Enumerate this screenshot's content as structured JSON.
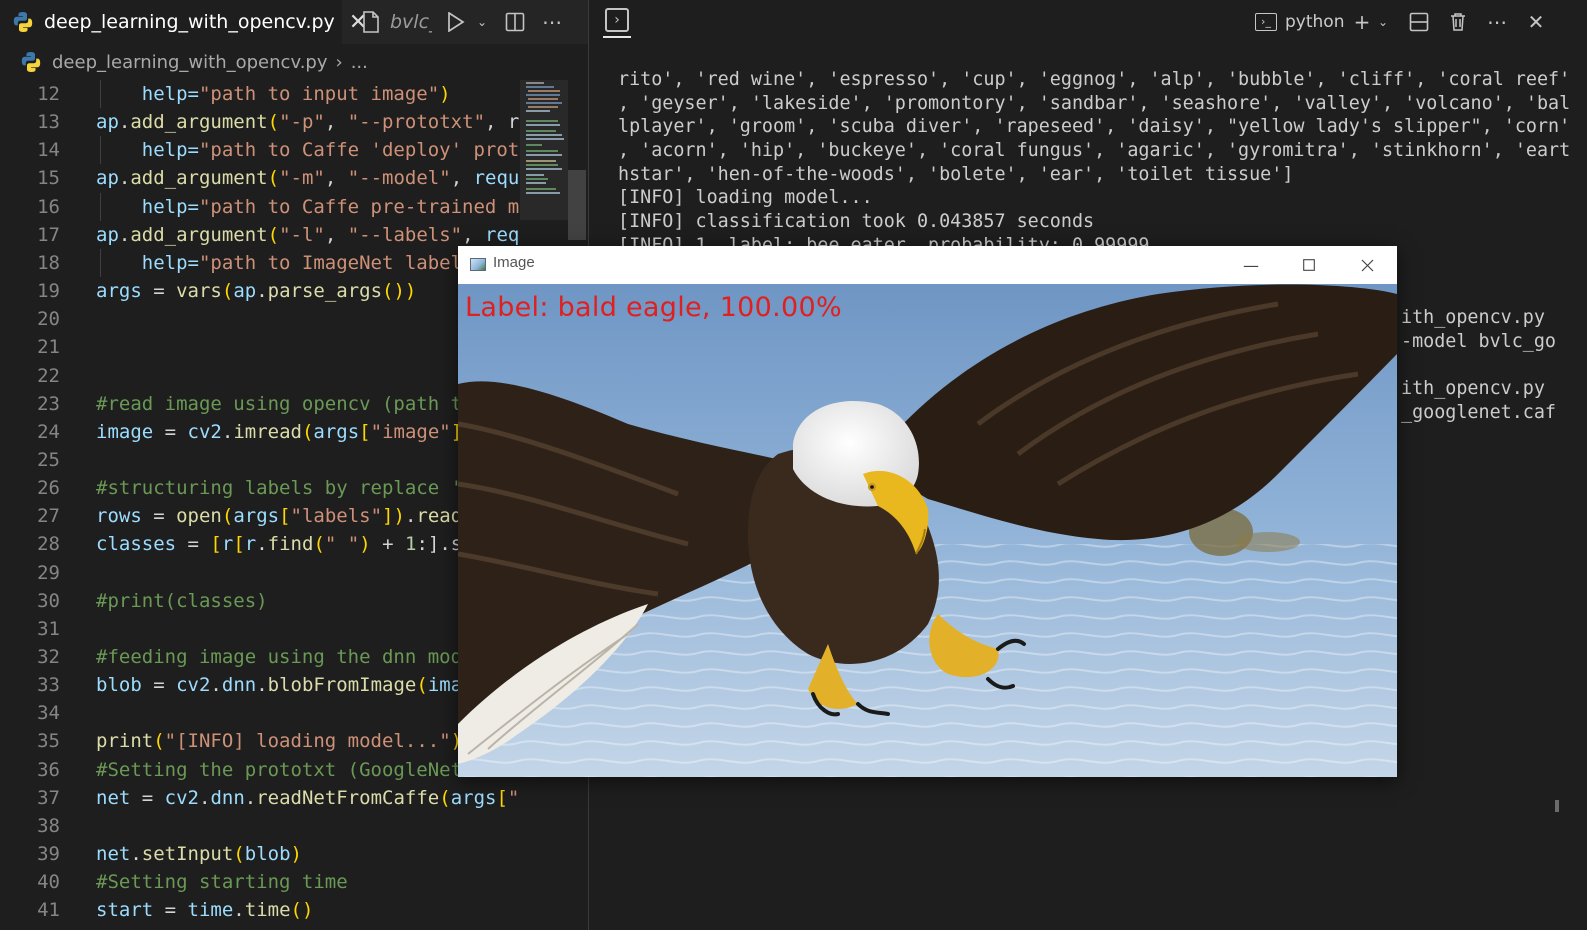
{
  "editor": {
    "active_tab": "deep_learning_with_opencv.py",
    "inactive_tab": "bvlc_",
    "breadcrumb_file": "deep_learning_with_opencv.py",
    "breadcrumb_more": "...",
    "lines": [
      {
        "n": "12",
        "segs": [
          [
            "    help=",
            "var"
          ],
          [
            "\"path to input image\"",
            "str"
          ],
          [
            ")",
            "br"
          ]
        ]
      },
      {
        "n": "13",
        "segs": [
          [
            "ap",
            "var"
          ],
          [
            ".",
            "op"
          ],
          [
            "add_argument",
            "fn"
          ],
          [
            "(",
            "br"
          ],
          [
            "\"-p\"",
            "str"
          ],
          [
            ", ",
            "op"
          ],
          [
            "\"--prototxt\"",
            "str"
          ],
          [
            ", r",
            "op"
          ]
        ]
      },
      {
        "n": "14",
        "segs": [
          [
            "    help=",
            "var"
          ],
          [
            "\"path to Caffe 'deploy' prot",
            "str"
          ]
        ]
      },
      {
        "n": "15",
        "segs": [
          [
            "ap",
            "var"
          ],
          [
            ".",
            "op"
          ],
          [
            "add_argument",
            "fn"
          ],
          [
            "(",
            "br"
          ],
          [
            "\"-m\"",
            "str"
          ],
          [
            ", ",
            "op"
          ],
          [
            "\"--model\"",
            "str"
          ],
          [
            ", ",
            "op"
          ],
          [
            "requ",
            "var"
          ]
        ]
      },
      {
        "n": "16",
        "segs": [
          [
            "    help=",
            "var"
          ],
          [
            "\"path to Caffe pre-trained m",
            "str"
          ]
        ]
      },
      {
        "n": "17",
        "segs": [
          [
            "ap",
            "var"
          ],
          [
            ".",
            "op"
          ],
          [
            "add_argument",
            "fn"
          ],
          [
            "(",
            "br"
          ],
          [
            "\"-l\"",
            "str"
          ],
          [
            ", ",
            "op"
          ],
          [
            "\"--labels\"",
            "str"
          ],
          [
            ", ",
            "op"
          ],
          [
            "req",
            "var"
          ]
        ]
      },
      {
        "n": "18",
        "segs": [
          [
            "    help=",
            "var"
          ],
          [
            "\"path to ImageNet label",
            "str"
          ]
        ]
      },
      {
        "n": "19",
        "segs": [
          [
            "args",
            "var"
          ],
          [
            " = ",
            "op"
          ],
          [
            "vars",
            "fn"
          ],
          [
            "(",
            "br"
          ],
          [
            "ap",
            "var"
          ],
          [
            ".",
            "op"
          ],
          [
            "parse_args",
            "fn"
          ],
          [
            "())",
            "br"
          ]
        ]
      },
      {
        "n": "20",
        "segs": []
      },
      {
        "n": "21",
        "segs": []
      },
      {
        "n": "22",
        "segs": []
      },
      {
        "n": "23",
        "segs": [
          [
            "#read image using opencv (path t",
            "cmt"
          ]
        ]
      },
      {
        "n": "24",
        "segs": [
          [
            "image",
            "var"
          ],
          [
            " = ",
            "op"
          ],
          [
            "cv2",
            "var"
          ],
          [
            ".",
            "op"
          ],
          [
            "imread",
            "fn"
          ],
          [
            "(",
            "br"
          ],
          [
            "args",
            "var"
          ],
          [
            "[",
            "br"
          ],
          [
            "\"image\"",
            "str"
          ],
          [
            "]",
            "br"
          ]
        ]
      },
      {
        "n": "25",
        "segs": []
      },
      {
        "n": "26",
        "segs": [
          [
            "#structuring labels by replace '",
            "cmt"
          ]
        ]
      },
      {
        "n": "27",
        "segs": [
          [
            "rows",
            "var"
          ],
          [
            " = ",
            "op"
          ],
          [
            "open",
            "fn"
          ],
          [
            "(",
            "br"
          ],
          [
            "args",
            "var"
          ],
          [
            "[",
            "br"
          ],
          [
            "\"labels\"",
            "str"
          ],
          [
            "])",
            "br"
          ],
          [
            ".",
            "op"
          ],
          [
            "read",
            "fn"
          ]
        ]
      },
      {
        "n": "28",
        "segs": [
          [
            "classes",
            "var"
          ],
          [
            " = ",
            "op"
          ],
          [
            "[",
            "br"
          ],
          [
            "r",
            "var"
          ],
          [
            "[",
            "br"
          ],
          [
            "r",
            "var"
          ],
          [
            ".",
            "op"
          ],
          [
            "find",
            "fn"
          ],
          [
            "(",
            "br"
          ],
          [
            "\" \"",
            "str"
          ],
          [
            ")",
            "br"
          ],
          [
            " + ",
            "op"
          ],
          [
            "1",
            "num"
          ],
          [
            ":].s",
            "op"
          ]
        ]
      },
      {
        "n": "29",
        "segs": []
      },
      {
        "n": "30",
        "segs": [
          [
            "#print(classes)",
            "cmt"
          ]
        ]
      },
      {
        "n": "31",
        "segs": []
      },
      {
        "n": "32",
        "segs": [
          [
            "#feeding image using the dnn mod",
            "cmt"
          ]
        ]
      },
      {
        "n": "33",
        "segs": [
          [
            "blob",
            "var"
          ],
          [
            " = ",
            "op"
          ],
          [
            "cv2",
            "var"
          ],
          [
            ".",
            "op"
          ],
          [
            "dnn",
            "var"
          ],
          [
            ".",
            "op"
          ],
          [
            "blobFromImage",
            "fn"
          ],
          [
            "(",
            "br"
          ],
          [
            "ima",
            "var"
          ]
        ]
      },
      {
        "n": "34",
        "segs": []
      },
      {
        "n": "35",
        "segs": [
          [
            "print",
            "fn"
          ],
          [
            "(",
            "br"
          ],
          [
            "\"[INFO] loading model...\"",
            "str"
          ],
          [
            ")",
            "br"
          ]
        ]
      },
      {
        "n": "36",
        "segs": [
          [
            "#Setting the prototxt (GoogleNet",
            "cmt"
          ]
        ]
      },
      {
        "n": "37",
        "segs": [
          [
            "net",
            "var"
          ],
          [
            " = ",
            "op"
          ],
          [
            "cv2",
            "var"
          ],
          [
            ".",
            "op"
          ],
          [
            "dnn",
            "var"
          ],
          [
            ".",
            "op"
          ],
          [
            "readNetFromCaffe",
            "fn"
          ],
          [
            "(",
            "br"
          ],
          [
            "args",
            "var"
          ],
          [
            "[",
            "br"
          ],
          [
            "\"",
            "str"
          ]
        ]
      },
      {
        "n": "38",
        "segs": []
      },
      {
        "n": "39",
        "segs": [
          [
            "net",
            "var"
          ],
          [
            ".",
            "op"
          ],
          [
            "setInput",
            "fn"
          ],
          [
            "(",
            "br"
          ],
          [
            "blob",
            "var"
          ],
          [
            ")",
            "br"
          ]
        ]
      },
      {
        "n": "40",
        "segs": [
          [
            "#Setting starting time",
            "cmt"
          ]
        ]
      },
      {
        "n": "41",
        "segs": [
          [
            "start",
            "var"
          ],
          [
            " = ",
            "op"
          ],
          [
            "time",
            "var"
          ],
          [
            ".",
            "op"
          ],
          [
            "time",
            "fn"
          ],
          [
            "()",
            "br"
          ]
        ]
      }
    ]
  },
  "terminal": {
    "profile_name": "python",
    "lines": [
      "rito', 'red wine', 'espresso', 'cup', 'eggnog', 'alp', 'bubble', 'cliff', 'coral reef'",
      ", 'geyser', 'lakeside', 'promontory', 'sandbar', 'seashore', 'valley', 'volcano', 'bal",
      "lplayer', 'groom', 'scuba diver', 'rapeseed', 'daisy', \"yellow lady's slipper\", 'corn'",
      ", 'acorn', 'hip', 'buckeye', 'coral fungus', 'agaric', 'gyromitra', 'stinkhorn', 'eart",
      "hstar', 'hen-of-the-woods', 'bolete', 'ear', 'toilet tissue']",
      "[INFO] loading model...",
      "[INFO] classification took 0.043857 seconds",
      "[INFO] 1. label: bee eater, probability: 0.99999"
    ],
    "right_fragments": [
      "ith_opencv.py",
      "-model bvlc_go",
      "ith_opencv.py",
      "_googlenet.caf"
    ]
  },
  "image_window": {
    "title": "Image",
    "overlay_label": "Label: bald eagle, 100.00%",
    "photo_subject": "bald-eagle-over-water-photo"
  },
  "colors": {
    "editor_bg": "#1e1e1e",
    "overlay_label": "#e02020",
    "water": "#8fb0d0"
  },
  "icons": {
    "python": "python-file-icon",
    "close": "close-icon",
    "run": "play-icon",
    "split": "split-editor-icon",
    "more": "ellipsis-icon",
    "terminal": "terminal-icon",
    "add": "plus-icon",
    "trash": "trash-icon"
  }
}
